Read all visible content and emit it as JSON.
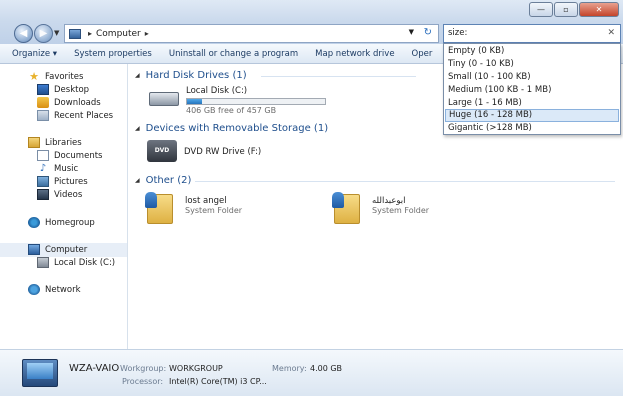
{
  "window": {
    "controls": {
      "minimize": "—",
      "maximize": "▫",
      "close": "✕"
    }
  },
  "address": {
    "segments": [
      "Computer"
    ],
    "separator": "▸"
  },
  "search": {
    "value": "size:",
    "clear": "✕"
  },
  "commands": [
    "Organize ▾",
    "System properties",
    "Uninstall or change a program",
    "Map network drive",
    "Oper"
  ],
  "nav": {
    "favorites": "Favorites",
    "desktop": "Desktop",
    "downloads": "Downloads",
    "recent": "Recent Places",
    "libraries": "Libraries",
    "documents": "Documents",
    "music": "Music",
    "pictures": "Pictures",
    "videos": "Videos",
    "homegroup": "Homegroup",
    "computer": "Computer",
    "local_disk": "Local Disk (C:)",
    "network": "Network"
  },
  "groups": {
    "hdd": {
      "title": "Hard Disk Drives (1)"
    },
    "removable": {
      "title": "Devices with Removable Storage (1)"
    },
    "other": {
      "title": "Other (2)"
    }
  },
  "drives": {
    "c": {
      "name": "Local Disk (C:)",
      "free": "406 GB free of 457 GB",
      "used_fraction": 0.11
    },
    "dvd": {
      "name": "DVD RW Drive (F:)",
      "badge": "DVD"
    }
  },
  "other_items": [
    {
      "name": "lost angel",
      "type": "System Folder"
    },
    {
      "name": "ابوعبدالله",
      "type": "System Folder"
    }
  ],
  "size_filter": {
    "options": [
      "Empty (0 KB)",
      "Tiny (0 - 10 KB)",
      "Small (10 - 100 KB)",
      "Medium (100 KB - 1 MB)",
      "Large (1 - 16 MB)",
      "Huge (16 - 128 MB)",
      "Gigantic (>128 MB)"
    ],
    "highlighted": "Huge (16 - 128 MB)"
  },
  "details": {
    "name": "WZA-VAIO",
    "workgroup_label": "Workgroup:",
    "workgroup_value": "WORKGROUP",
    "memory_label": "Memory:",
    "memory_value": "4.00 GB",
    "processor_label": "Processor:",
    "processor_value": "Intel(R) Core(TM) i3 CP..."
  },
  "colors": {
    "accent": "#1e4e8c",
    "highlight": "#dbe9f8"
  }
}
